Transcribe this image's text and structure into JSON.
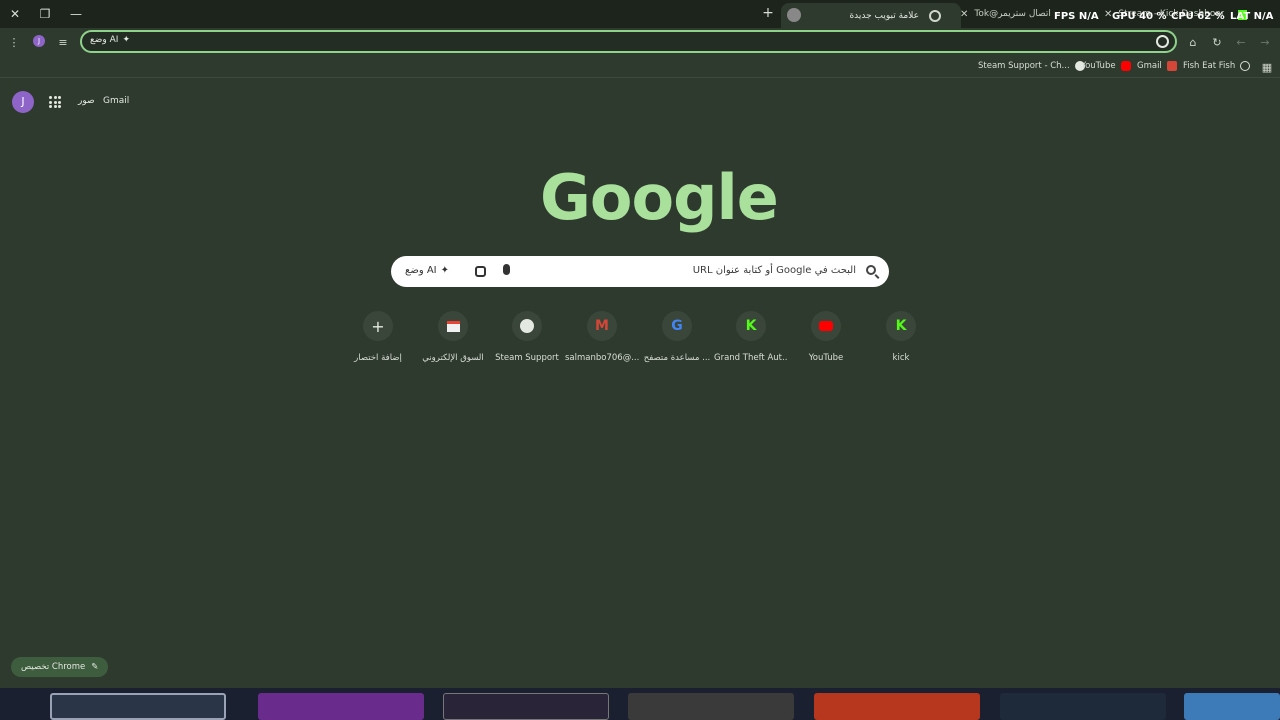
{
  "window": {
    "active_tab_title": "علامة تبويب جديدة",
    "tab2_title": "Tok@اتصال ستريمر",
    "tab3_title": "Stream - Kick Dashboard"
  },
  "overlay": {
    "fps_label": "FPS",
    "fps_value": "N/A",
    "gpu_label": "GPU",
    "gpu_value": "40 %",
    "cpu_label": "CPU",
    "cpu_value": "62 %",
    "lat_label": "LAT",
    "lat_value": "N/A"
  },
  "omnibox": {
    "ai_mode_label": "وضع AI"
  },
  "bookmarks": [
    {
      "label": "Steam Support - Ch...",
      "icon": "steam-icon"
    },
    {
      "label": "YouTube",
      "icon": "youtube-icon"
    },
    {
      "label": "Gmail",
      "icon": "gmail-icon"
    },
    {
      "label": "Fish Eat Fish",
      "icon": "globe-icon"
    }
  ],
  "header": {
    "avatar_letter": "J",
    "images_link": "صور",
    "gmail_link": "Gmail"
  },
  "logo": {
    "text": "Google"
  },
  "search": {
    "placeholder": "البحث في Google أو كتابة عنوان URL",
    "ai_mode_label": "وضع AI"
  },
  "shortcuts": [
    {
      "label": "kick",
      "icon": "kick-icon"
    },
    {
      "label": "YouTube",
      "icon": "youtube-icon"
    },
    {
      "label": "Grand Theft Aut...",
      "icon": "kick-icon"
    },
    {
      "label": "مساعدة متصفح ...",
      "icon": "google-icon"
    },
    {
      "label": "salmanbo706@...",
      "icon": "gmail-icon"
    },
    {
      "label": "Steam Support",
      "icon": "steam-icon"
    },
    {
      "label": "السوق الإلكتروني",
      "icon": "store-icon"
    },
    {
      "label": "إضافة اختصار",
      "icon": "plus-icon"
    }
  ],
  "customize": {
    "label": "تخصيص Chrome"
  },
  "colors": {
    "background": "#2f3a2f",
    "accent": "#a8e09c",
    "kick_green": "#53fc18",
    "youtube_red": "#ff0000"
  }
}
